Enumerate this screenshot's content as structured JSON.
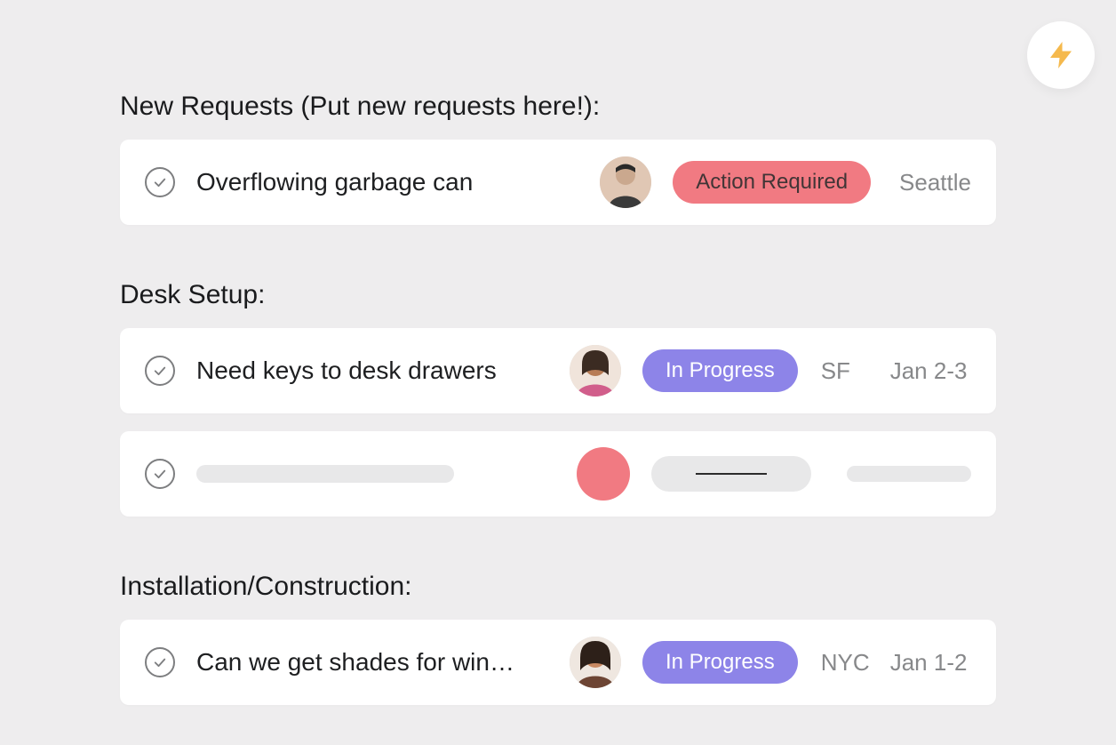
{
  "colors": {
    "status_red": "#f17a82",
    "status_purple": "#8d84e8"
  },
  "sections": [
    {
      "title": "New Requests (Put new requests here!):",
      "tasks": [
        {
          "title": "Overflowing garbage can",
          "assignee": "person-1",
          "status_label": "Action Required",
          "status_color": "red",
          "location": "Seattle",
          "date": ""
        }
      ]
    },
    {
      "title": "Desk Setup:",
      "tasks": [
        {
          "title": "Need keys to desk drawers",
          "assignee": "person-2",
          "status_label": "In Progress",
          "status_color": "purple",
          "location": "SF",
          "date": "Jan 2-3"
        },
        {
          "placeholder": true
        }
      ]
    },
    {
      "title": "Installation/Construction:",
      "tasks": [
        {
          "title": "Can we get shades for win…",
          "assignee": "person-3",
          "status_label": "In Progress",
          "status_color": "purple",
          "location": "NYC",
          "date": "Jan 1-2"
        }
      ]
    }
  ]
}
